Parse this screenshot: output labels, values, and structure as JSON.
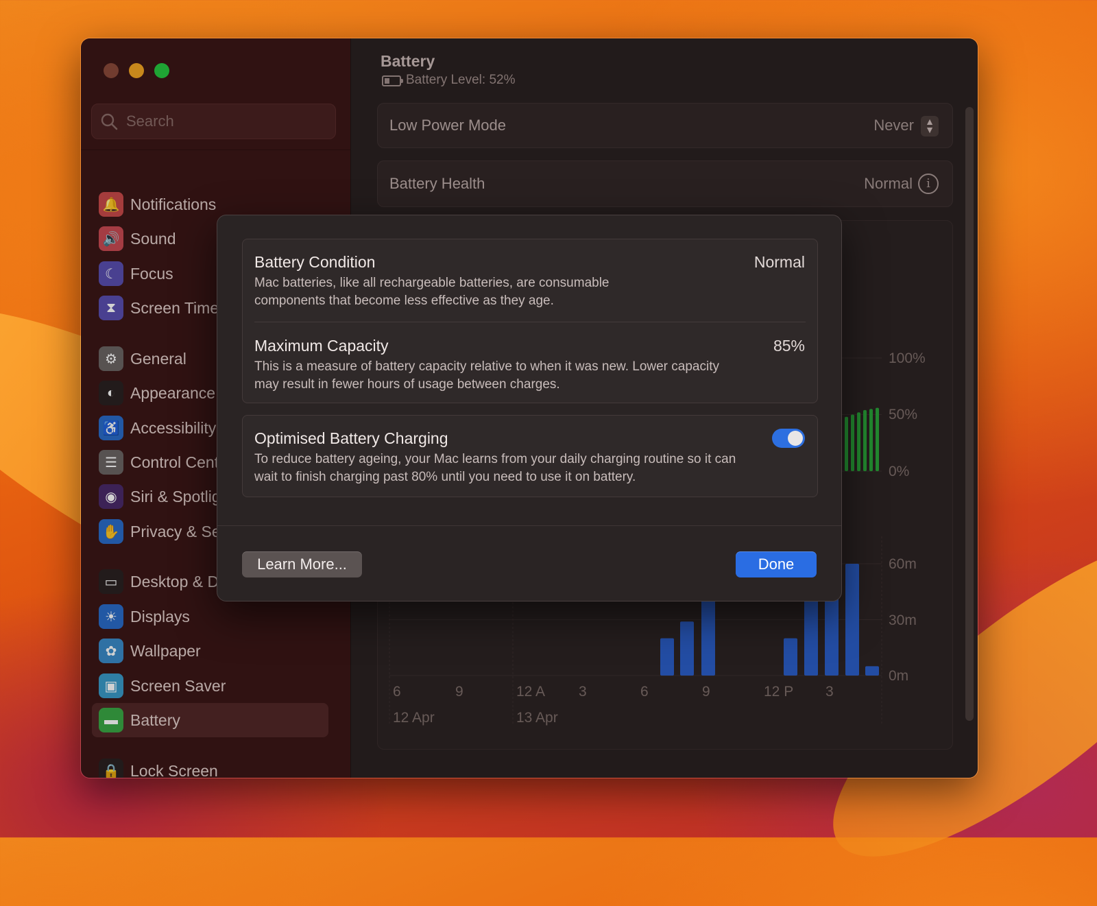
{
  "sidebar": {
    "search_placeholder": "Search",
    "items": [
      {
        "label": "Notifications",
        "icon": "bell-icon",
        "color": "#c94a4a"
      },
      {
        "label": "Sound",
        "icon": "speaker-icon",
        "color": "#c94a52"
      },
      {
        "label": "Focus",
        "icon": "moon-icon",
        "color": "#5a4fb0"
      },
      {
        "label": "Screen Time",
        "icon": "hourglass-icon",
        "color": "#5a4fb0"
      },
      {
        "label": "General",
        "icon": "gear-icon",
        "color": "#6b6463"
      },
      {
        "label": "Appearance",
        "icon": "appearance-icon",
        "color": "#2a2222"
      },
      {
        "label": "Accessibility",
        "icon": "accessibility-icon",
        "color": "#2a6cc9"
      },
      {
        "label": "Control Centre",
        "icon": "toggles-icon",
        "color": "#6b6463"
      },
      {
        "label": "Siri & Spotlight",
        "icon": "siri-icon",
        "color": "#4a2a6a"
      },
      {
        "label": "Privacy & Security",
        "icon": "hand-icon",
        "color": "#2a6cc9"
      },
      {
        "label": "Desktop & Dock",
        "icon": "dock-icon",
        "color": "#2a2222"
      },
      {
        "label": "Displays",
        "icon": "sun-icon",
        "color": "#2a6cc9"
      },
      {
        "label": "Wallpaper",
        "icon": "flower-icon",
        "color": "#3a8ac9"
      },
      {
        "label": "Screen Saver",
        "icon": "screensaver-icon",
        "color": "#3a9ac9"
      },
      {
        "label": "Battery",
        "icon": "battery-icon",
        "color": "#3aa845"
      },
      {
        "label": "Lock Screen",
        "icon": "lock-icon",
        "color": "#2a2222"
      }
    ]
  },
  "content": {
    "title": "Battery",
    "subtitle": "Battery Level: 52%",
    "low_power_label": "Low Power Mode",
    "low_power_value": "Never",
    "health_label": "Battery Health",
    "health_value": "Normal",
    "y_axis_top": [
      "100%",
      "50%",
      "0%"
    ],
    "y_axis_bottom": [
      "60m",
      "30m",
      "0m"
    ],
    "x_ticks": [
      "6",
      "9",
      "12 A",
      "3",
      "6",
      "9",
      "12 P",
      "3"
    ],
    "dates": [
      "12 Apr",
      "13 Apr"
    ]
  },
  "chart_data": [
    {
      "type": "bar",
      "title": "",
      "ylabel": "",
      "ylim": [
        0,
        100
      ],
      "yticks": [
        "0%",
        "50%",
        "100%"
      ],
      "series": [
        {
          "values": [
            45,
            48,
            50,
            52,
            54,
            55,
            56
          ]
        }
      ]
    },
    {
      "type": "bar",
      "title": "",
      "ylabel": "",
      "ylim": [
        0,
        60
      ],
      "yticks": [
        "0m",
        "30m",
        "60m"
      ],
      "x": [
        "6",
        "9",
        "12 A",
        "3",
        "6",
        "9",
        "12 P",
        "3"
      ],
      "series": [
        {
          "values": [
            20,
            29,
            60,
            20,
            60,
            60,
            60,
            5
          ]
        }
      ]
    }
  ],
  "dialog": {
    "condition_title": "Battery Condition",
    "condition_value": "Normal",
    "condition_desc": "Mac batteries, like all rechargeable batteries, are consumable components that become less effective as they age.",
    "capacity_title": "Maximum Capacity",
    "capacity_value": "85%",
    "capacity_desc": "This is a measure of battery capacity relative to when it was new. Lower capacity may result in fewer hours of usage between charges.",
    "optimised_title": "Optimised Battery Charging",
    "optimised_on": true,
    "optimised_desc": "To reduce battery ageing, your Mac learns from your daily charging routine so it can wait to finish charging past 80% until you need to use it on battery.",
    "learn_more": "Learn More...",
    "done": "Done"
  },
  "colors": {
    "accent": "#2a6de3",
    "battery_green": "#2aa63a",
    "usage_blue": "#2b5fc9"
  }
}
